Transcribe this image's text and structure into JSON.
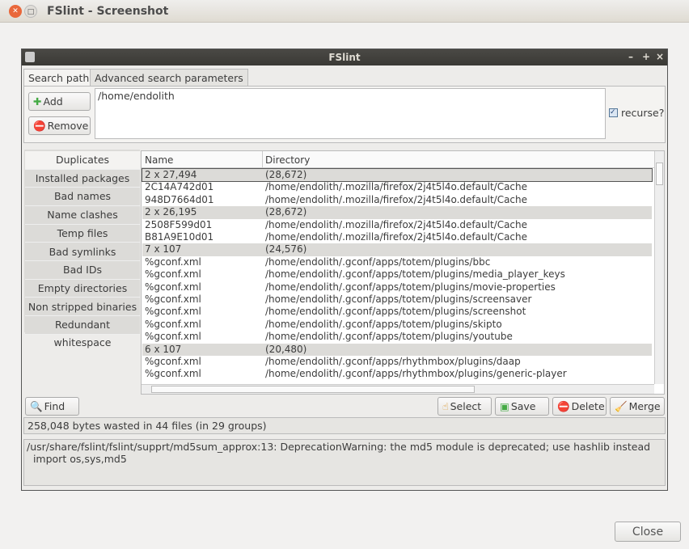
{
  "window": {
    "title": "FSlint - Screenshot",
    "close_label": "Close"
  },
  "dialog": {
    "title": "FSlint",
    "controls": [
      "–",
      "+",
      "×"
    ]
  },
  "tabs": [
    "Search path",
    "Advanced search parameters"
  ],
  "search": {
    "add_label": "Add",
    "remove_label": "Remove",
    "paths": [
      "/home/endolith"
    ],
    "recurse_label": "recurse?",
    "recurse_checked": true
  },
  "sidebar": [
    "Duplicates",
    "Installed packages",
    "Bad names",
    "Name clashes",
    "Temp files",
    "Bad symlinks",
    "Bad IDs",
    "Empty directories",
    "Non stripped binaries",
    "Redundant whitespace"
  ],
  "sidebar_selected": "Duplicates",
  "table": {
    "headers": [
      "Name",
      "Directory"
    ],
    "rows": [
      {
        "group": true,
        "name": "2 x 27,494",
        "dir": "(28,672)"
      },
      {
        "name": "2C14A742d01",
        "dir": "/home/endolith/.mozilla/firefox/2j4t5l4o.default/Cache"
      },
      {
        "name": "948D7664d01",
        "dir": "/home/endolith/.mozilla/firefox/2j4t5l4o.default/Cache"
      },
      {
        "group": true,
        "name": "2 x 26,195",
        "dir": "(28,672)"
      },
      {
        "name": "2508F599d01",
        "dir": "/home/endolith/.mozilla/firefox/2j4t5l4o.default/Cache"
      },
      {
        "name": "B81A9E10d01",
        "dir": "/home/endolith/.mozilla/firefox/2j4t5l4o.default/Cache"
      },
      {
        "group": true,
        "name": "7 x 107",
        "dir": "(24,576)"
      },
      {
        "name": "%gconf.xml",
        "dir": "/home/endolith/.gconf/apps/totem/plugins/bbc"
      },
      {
        "name": "%gconf.xml",
        "dir": "/home/endolith/.gconf/apps/totem/plugins/media_player_keys"
      },
      {
        "name": "%gconf.xml",
        "dir": "/home/endolith/.gconf/apps/totem/plugins/movie-properties"
      },
      {
        "name": "%gconf.xml",
        "dir": "/home/endolith/.gconf/apps/totem/plugins/screensaver"
      },
      {
        "name": "%gconf.xml",
        "dir": "/home/endolith/.gconf/apps/totem/plugins/screenshot"
      },
      {
        "name": "%gconf.xml",
        "dir": "/home/endolith/.gconf/apps/totem/plugins/skipto"
      },
      {
        "name": "%gconf.xml",
        "dir": "/home/endolith/.gconf/apps/totem/plugins/youtube"
      },
      {
        "group": true,
        "name": "6 x 107",
        "dir": "(20,480)"
      },
      {
        "name": "%gconf.xml",
        "dir": "/home/endolith/.gconf/apps/rhythmbox/plugins/daap"
      },
      {
        "name": "%gconf.xml",
        "dir": "/home/endolith/.gconf/apps/rhythmbox/plugins/generic-player"
      }
    ]
  },
  "actions": {
    "find": "Find",
    "select": "Select",
    "save": "Save",
    "delete": "Delete",
    "merge": "Merge"
  },
  "status": "258,048 bytes wasted in 44 files (in 29 groups)",
  "log": [
    "/usr/share/fslint/fslint/supprt/md5sum_approx:13: DeprecationWarning: the md5 module is deprecated; use hashlib instead",
    "  import os,sys,md5"
  ]
}
